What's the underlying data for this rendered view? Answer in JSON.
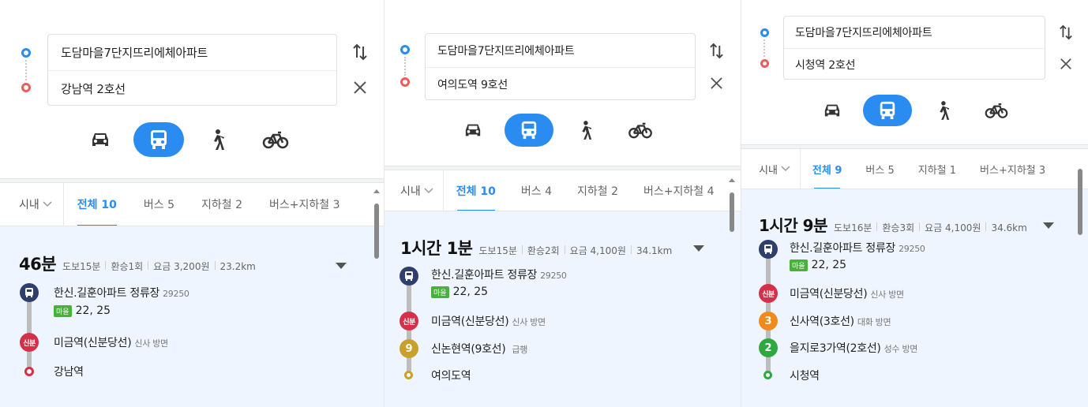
{
  "panels": [
    {
      "origin": "도담마을7단지뜨리에체아파트",
      "destination": "강남역 2호선",
      "tabs": {
        "region": "시내",
        "all": "전체 10",
        "bus": "버스 5",
        "subway": "지하철 2",
        "bus_subway": "버스+지하철 3"
      },
      "summary": {
        "time": "46분",
        "walk": "도보15분",
        "transfer": "환승1회",
        "fare": "요금 3,200원",
        "distance": "23.2km"
      },
      "steps": {
        "s1": {
          "name": "한신.길훈아파트 정류장",
          "sub": "29250"
        },
        "bus_badge": "마을",
        "bus_numbers": "22, 25",
        "s2": {
          "badge": "신분",
          "name": "미금역(신분당선)",
          "sub": "신사 방면"
        },
        "end": {
          "name": "강남역"
        }
      }
    },
    {
      "origin": "도담마을7단지뜨리에체아파트",
      "destination": "여의도역 9호선",
      "tabs": {
        "region": "시내",
        "all": "전체 10",
        "bus": "버스 4",
        "subway": "지하철 2",
        "bus_subway": "버스+지하철 4"
      },
      "summary": {
        "time": "1시간 1분",
        "walk": "도보15분",
        "transfer": "환승2회",
        "fare": "요금 4,100원",
        "distance": "34.1km"
      },
      "steps": {
        "s1": {
          "name": "한신.길훈아파트 정류장",
          "sub": "29250"
        },
        "bus_badge": "마을",
        "bus_numbers": "22, 25",
        "s2": {
          "badge": "신분",
          "name": "미금역(신분당선)",
          "sub": "신사 방면"
        },
        "s3": {
          "badge": "9",
          "name": "신논현역(9호선)",
          "sub": "급행"
        },
        "end": {
          "name": "여의도역"
        }
      }
    },
    {
      "origin": "도담마을7단지뜨리에체아파트",
      "destination": "시청역 2호선",
      "tabs": {
        "region": "시내",
        "all": "전체 9",
        "bus": "버스 5",
        "subway": "지하철 1",
        "bus_subway": "버스+지하철 3"
      },
      "summary": {
        "time": "1시간 9분",
        "walk": "도보16분",
        "transfer": "환승3회",
        "fare": "요금 4,100원",
        "distance": "34.6km"
      },
      "steps": {
        "s1": {
          "name": "한신.길훈아파트 정류장",
          "sub": "29250"
        },
        "bus_badge": "마을",
        "bus_numbers": "22, 25",
        "s2": {
          "badge": "신분",
          "name": "미금역(신분당선)",
          "sub": "신사 방면"
        },
        "s3": {
          "badge": "3",
          "name": "신사역(3호선)",
          "sub": "대화 방면"
        },
        "s4": {
          "badge": "2",
          "name": "을지로3가역(2호선)",
          "sub": "성수 방면"
        },
        "end": {
          "name": "시청역"
        }
      }
    }
  ],
  "icons": {
    "swap": "swap-arrows-icon",
    "clear": "close-icon",
    "car": "car-icon",
    "bus": "bus-icon",
    "walk": "walk-icon",
    "bike": "bicycle-icon",
    "dropdown": "chevron-down-icon",
    "expand": "caret-down-icon"
  },
  "colors": {
    "accent": "#2a8cf0",
    "origin_dot": "#2a8cf0",
    "dest_dot": "#ef5b5b",
    "bus_node": "#2e3f6e",
    "sinbundang": "#d5304a",
    "line9": "#c9a02b",
    "line3": "#f08a1f",
    "line2": "#2fa840",
    "result_bg": "#eef5fe"
  }
}
